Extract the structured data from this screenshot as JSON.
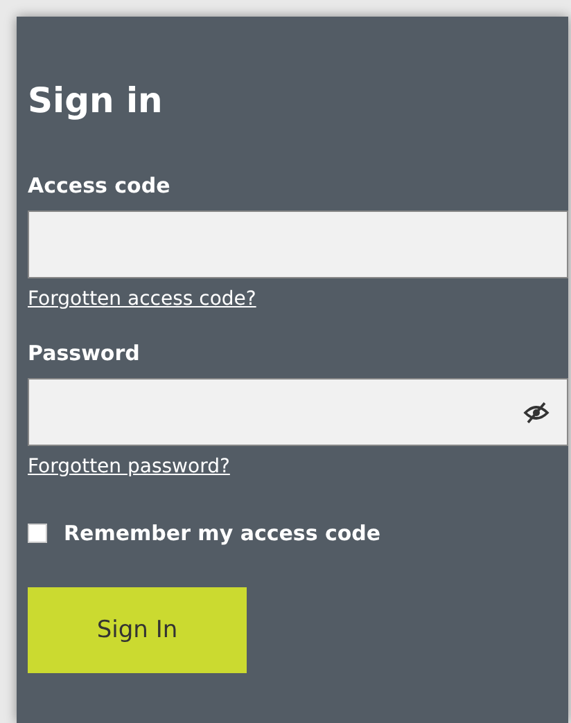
{
  "title": "Sign in",
  "fields": [
    {
      "label": "Access code",
      "link": "Forgotten access code?",
      "kind": "text"
    },
    {
      "label": "Password",
      "link": "Forgotten password?",
      "kind": "password"
    }
  ],
  "remember": {
    "label": "Remember my access code",
    "checked": false
  },
  "button": "Sign In"
}
